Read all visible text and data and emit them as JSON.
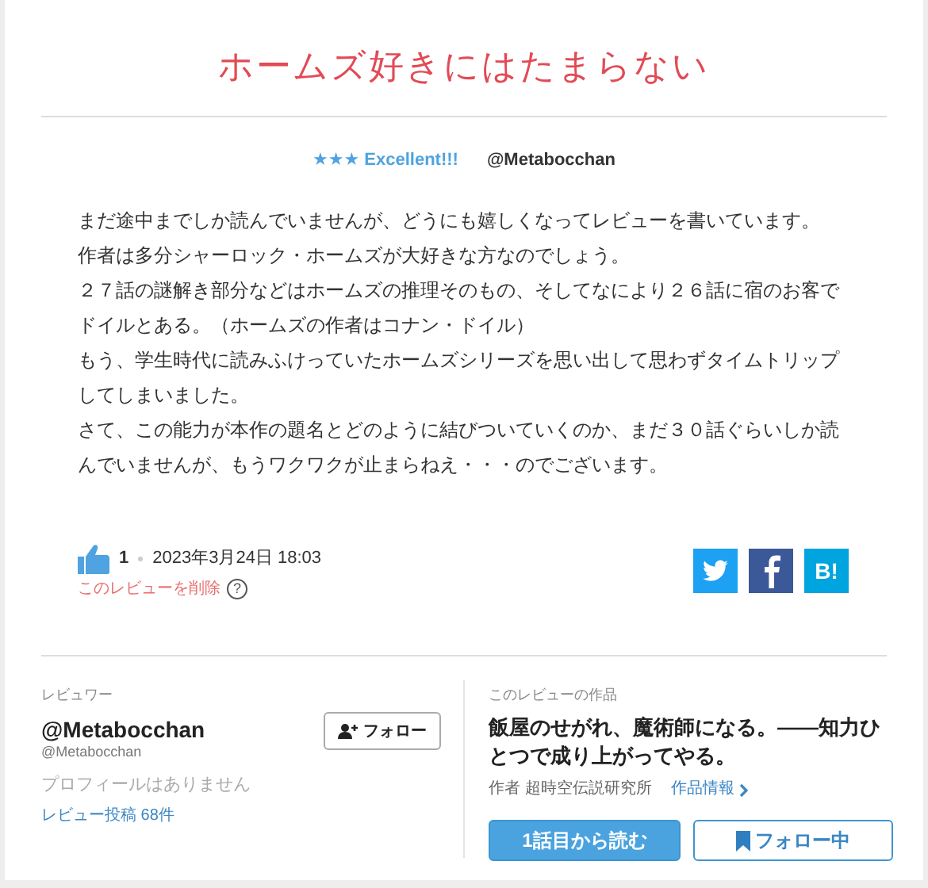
{
  "title": "ホームズ好きにはたまらない",
  "rating": {
    "stars": "★★★",
    "label": "Excellent!!!",
    "author": "@Metabocchan"
  },
  "body": [
    "まだ途中までしか読んでいませんが、どうにも嬉しくなってレビューを書いています。",
    "作者は多分シャーロック・ホームズが大好きな方なのでしょう。",
    "２７話の謎解き部分などはホームズの推理そのもの、そしてなにより２６話に宿のお客でドイルとある。（ホームズの作者はコナン・ドイル）",
    "もう、学生時代に読みふけっていたホームズシリーズを思い出して思わずタイムトリップしてしまいました。",
    "さて、この能力が本作の題名とどのように結びついていくのか、まだ３０話ぐらいしか読んでいませんが、もうワクワクが止まらねえ・・・のでございます。"
  ],
  "likes": "1",
  "date": "2023年3月24日 18:03",
  "delete_link": "このレビューを削除",
  "help": "?",
  "share": [
    {
      "kind": "twitter"
    },
    {
      "kind": "facebook"
    },
    {
      "kind": "hatena",
      "label": "B!"
    }
  ],
  "reviewer": {
    "heading": "レビュワー",
    "name": "@Metabocchan",
    "handle": "@Metabocchan",
    "profile": "プロフィールはありません",
    "posts": "レビュー投稿 68件",
    "follow": "フォロー"
  },
  "work": {
    "heading": "このレビューの作品",
    "title": "飯屋のせがれ、魔術師になる。――知力ひとつで成り上がってやる。",
    "author": "作者 超時空伝説研究所",
    "info": "作品情報",
    "read": "1話目から読む",
    "following": "フォロー中"
  }
}
